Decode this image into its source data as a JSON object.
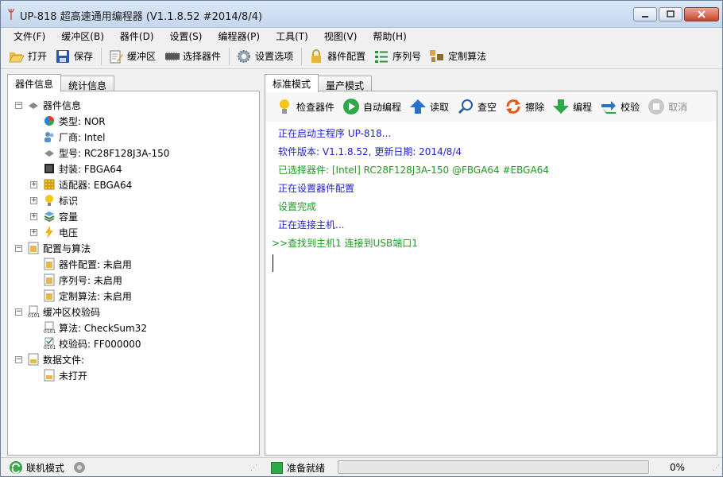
{
  "window": {
    "title": "UP-818 超高速通用编程器  (V1.1.8.52 #2014/8/4)",
    "app_icon_glyph": "ᛘ"
  },
  "menu": [
    "文件(F)",
    "缓冲区(B)",
    "器件(D)",
    "设置(S)",
    "编程器(P)",
    "工具(T)",
    "视图(V)",
    "帮助(H)"
  ],
  "toolbar": {
    "open": "打开",
    "save": "保存",
    "buffer": "缓冲区",
    "select_device": "选择器件",
    "settings": "设置选项",
    "device_config": "器件配置",
    "serial": "序列号",
    "custom_algo": "定制算法"
  },
  "left_tabs": {
    "device_info": "器件信息",
    "stats": "统计信息"
  },
  "tree": {
    "device_info": "器件信息",
    "type": "类型: NOR",
    "vendor": "厂商: Intel",
    "model": "型号: RC28F128J3A-150",
    "package": "封装: FBGA64",
    "adapter": "适配器: EBGA64",
    "mark": "标识",
    "capacity": "容量",
    "voltage": "电压",
    "config_algo": "配置与算法",
    "dev_config": "器件配置: 未启用",
    "serial": "序列号: 未启用",
    "custom_algo": "定制算法: 未启用",
    "buffer_checksum": "缓冲区校验码",
    "algo": "算法: CheckSum32",
    "checksum": "校验码: FF000000",
    "data_file": "数据文件:",
    "not_opened": "未打开"
  },
  "right_tabs": {
    "standard": "标准模式",
    "mass": "量产模式"
  },
  "actions": {
    "check": "检查器件",
    "auto": "自动编程",
    "read": "读取",
    "blank": "查空",
    "erase": "擦除",
    "program": "编程",
    "verify": "校验",
    "cancel": "取消"
  },
  "log": [
    {
      "text": "正在启动主程序 UP-818...",
      "color": "#1f1fd0"
    },
    {
      "text": "软件版本: V1.1.8.52, 更新日期: 2014/8/4",
      "color": "#1f1fd0"
    },
    {
      "text": "已选择器件: [Intel] RC28F128J3A-150 @FBGA64 #EBGA64",
      "color": "#1f9a1f"
    },
    {
      "text": "正在设置器件配置",
      "color": "#1f1fd0"
    },
    {
      "text": "设置完成",
      "color": "#1f9a1f"
    },
    {
      "text": "正在连接主机...",
      "color": "#1f1fd0"
    },
    {
      "text": ">>查找到主机1 连接到USB端口1",
      "color": "#1f9a1f"
    }
  ],
  "status": {
    "mode": "联机模式",
    "ready": "准备就绪",
    "progress_percent": 0,
    "progress_text": "0%"
  }
}
